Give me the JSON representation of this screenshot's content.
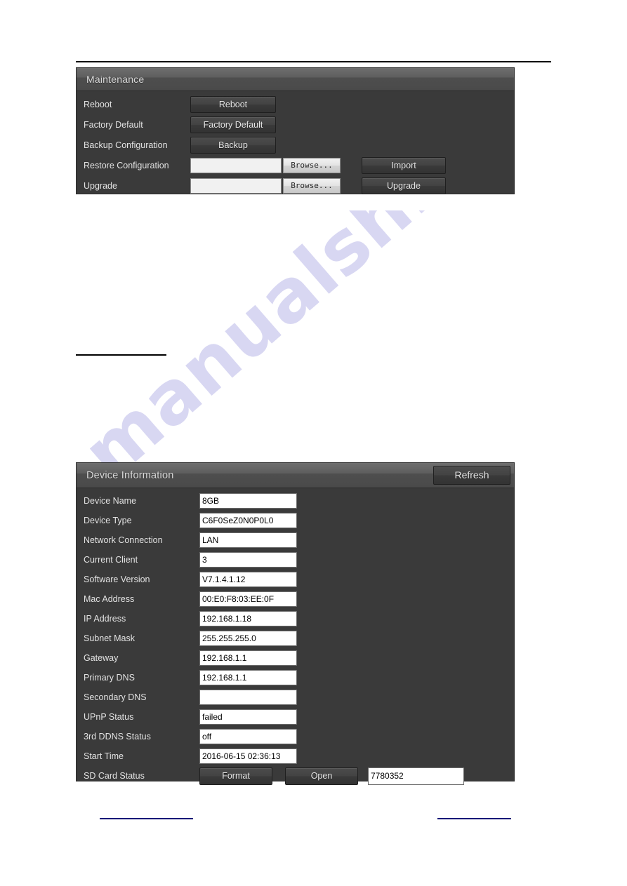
{
  "watermark": {
    "text": "manualshive.com"
  },
  "maintenance": {
    "title": "Maintenance",
    "rows": [
      {
        "label": "Reboot",
        "button": "Reboot"
      },
      {
        "label": "Factory Default",
        "button": "Factory Default"
      },
      {
        "label": "Backup Configuration",
        "button": "Backup"
      },
      {
        "label": "Restore Configuration",
        "field": "",
        "browse": "Browse...",
        "action": "Import"
      },
      {
        "label": "Upgrade",
        "field": "",
        "browse": "Browse...",
        "action": "Upgrade"
      }
    ]
  },
  "device_information": {
    "title": "Device Information",
    "refresh_label": "Refresh",
    "rows": [
      {
        "label": "Device Name",
        "value": "8GB"
      },
      {
        "label": "Device Type",
        "value": "C6F0SeZ0N0P0L0"
      },
      {
        "label": "Network Connection",
        "value": "LAN"
      },
      {
        "label": "Current Client",
        "value": "3"
      },
      {
        "label": "Software Version",
        "value": "V7.1.4.1.12"
      },
      {
        "label": "Mac Address",
        "value": "00:E0:F8:03:EE:0F"
      },
      {
        "label": "IP Address",
        "value": "192.168.1.18"
      },
      {
        "label": "Subnet Mask",
        "value": "255.255.255.0"
      },
      {
        "label": "Gateway",
        "value": "192.168.1.1"
      },
      {
        "label": "Primary DNS",
        "value": "192.168.1.1"
      },
      {
        "label": "Secondary DNS",
        "value": ""
      },
      {
        "label": "UPnP Status",
        "value": "failed"
      },
      {
        "label": "3rd DDNS Status",
        "value": "off"
      },
      {
        "label": "Start Time",
        "value": "2016-06-15 02:36:13"
      }
    ],
    "sd_card": {
      "label": "SD Card Status",
      "format_label": "Format",
      "open_label": "Open",
      "value": "7780352"
    }
  },
  "colors": {
    "panel_body": "#3a3a3a",
    "panel_header": "#5e5e5e",
    "text": "#e2e2e2",
    "rule_black": "#000000",
    "rule_blue": "#141878",
    "watermark": "#b9b7e8"
  }
}
